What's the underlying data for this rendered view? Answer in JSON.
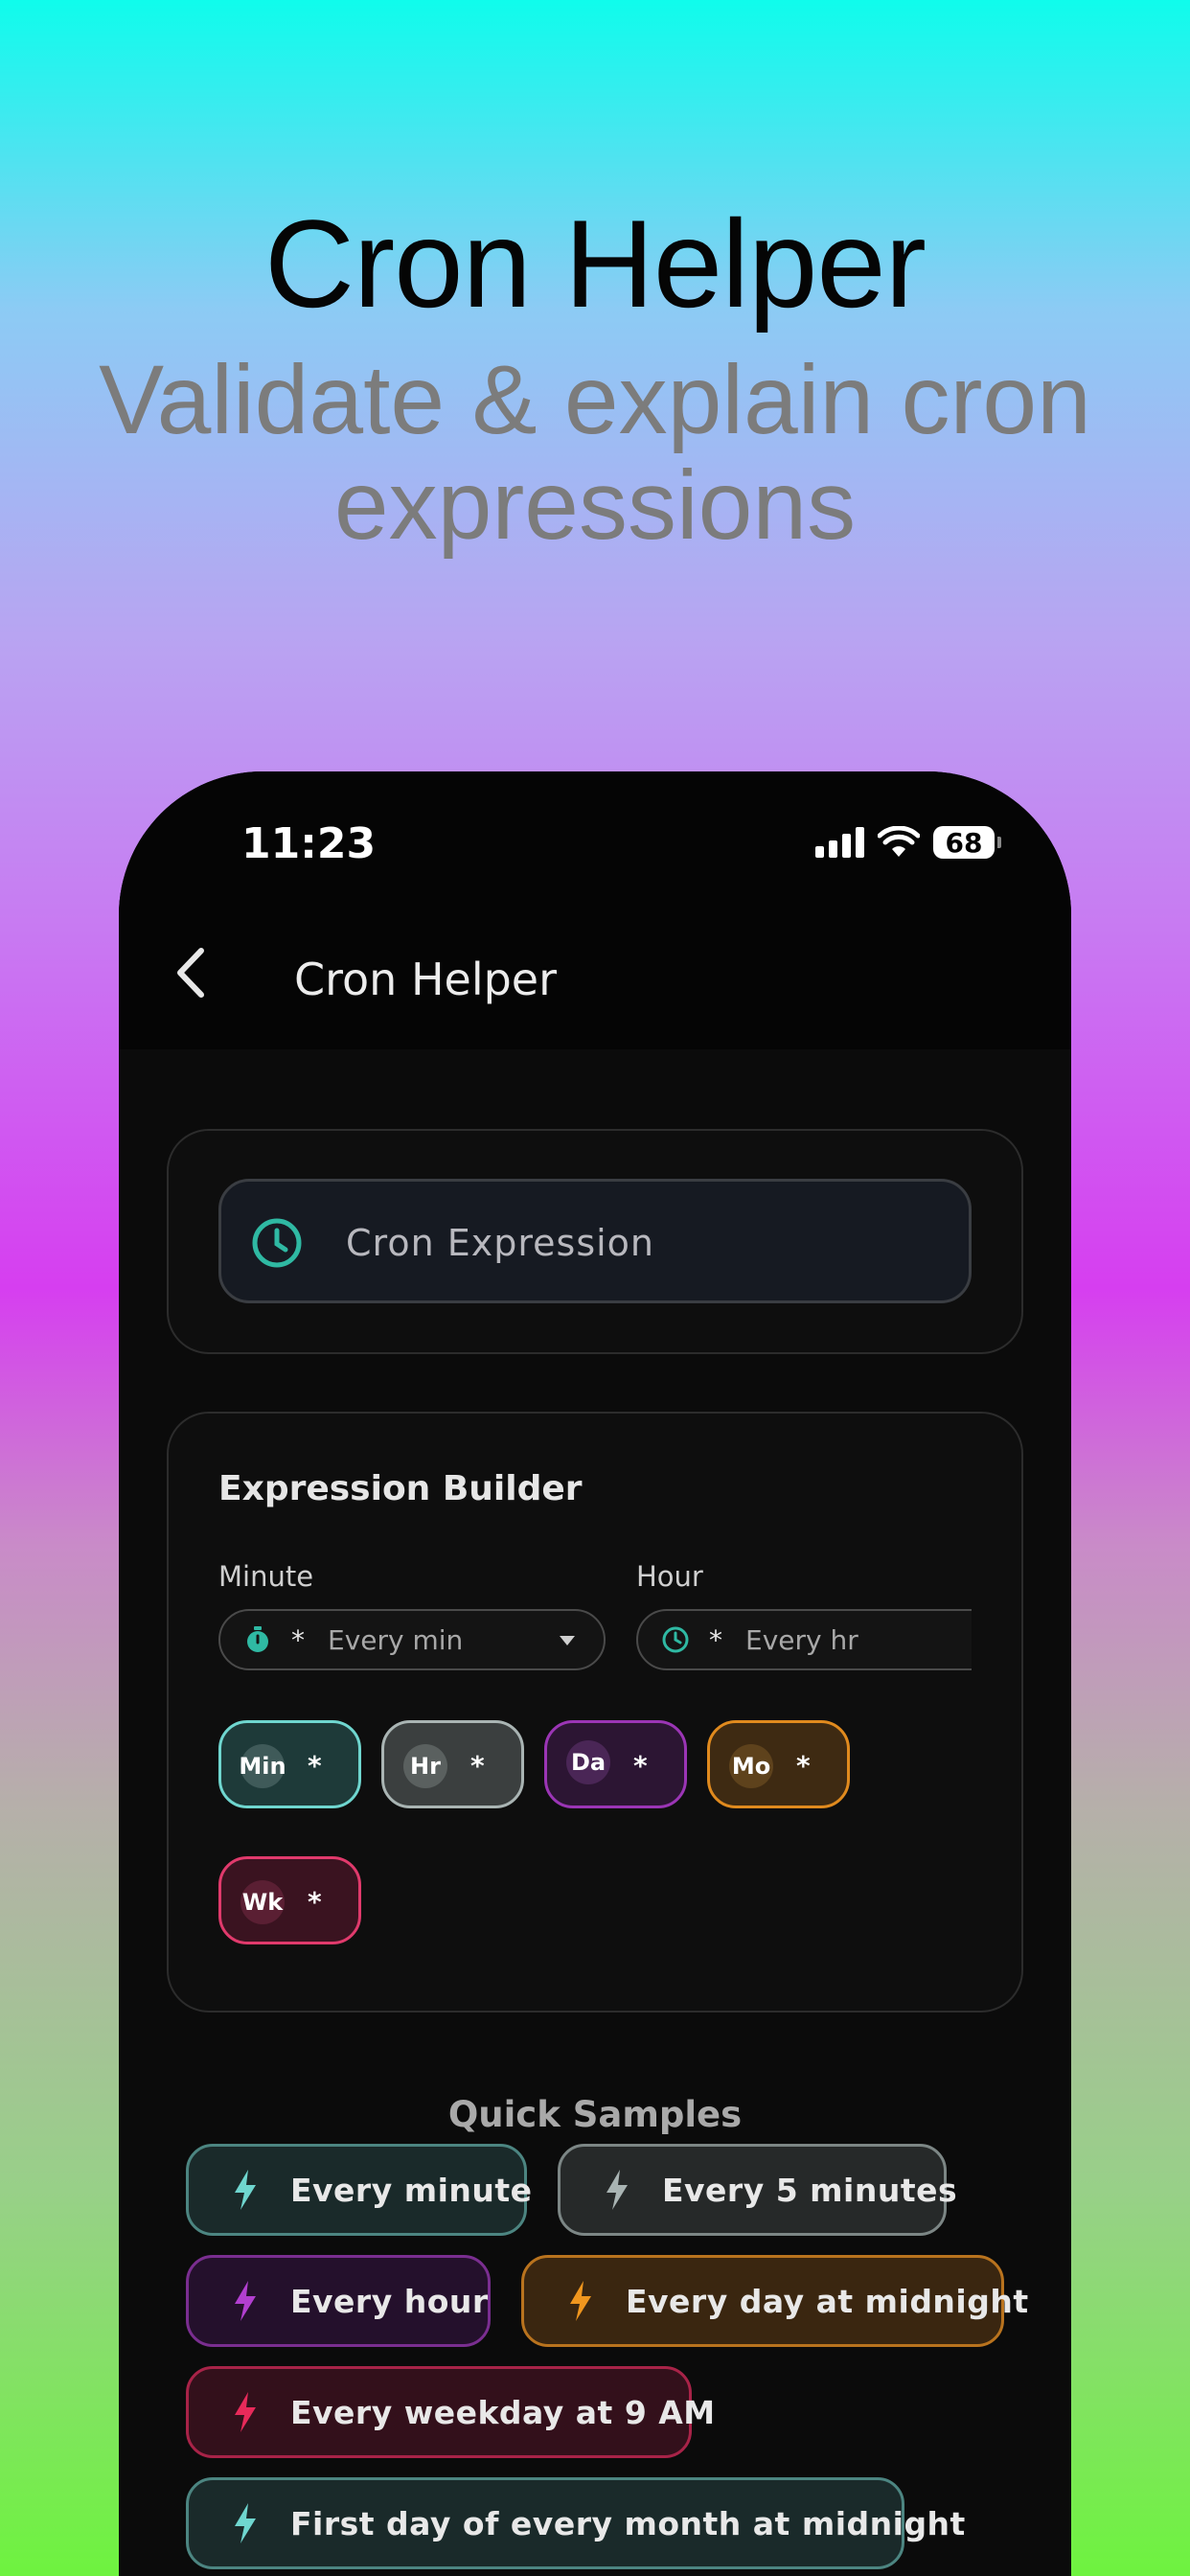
{
  "hero": {
    "title": "Cron Helper",
    "subtitle": "Validate & explain cron expressions"
  },
  "status_bar": {
    "time": "11:23",
    "battery": "68"
  },
  "app_bar": {
    "title": "Cron Helper"
  },
  "cron_input": {
    "placeholder": "Cron Expression"
  },
  "builder": {
    "title": "Expression Builder",
    "minute": {
      "label": "Minute",
      "value": "*",
      "text": "Every min"
    },
    "hour": {
      "label": "Hour",
      "value": "*",
      "text": "Every hr"
    },
    "chips": [
      {
        "badge": "Min",
        "value": "*",
        "color": "#6fd6cf"
      },
      {
        "badge": "Hr",
        "value": "*",
        "color": "#a9b4b3"
      },
      {
        "badge": "Da",
        "value": "*",
        "color": "#9b35b5"
      },
      {
        "badge": "Mo",
        "value": "*",
        "color": "#e08a1e"
      },
      {
        "badge": "Wk",
        "value": "*",
        "color": "#e03a6c"
      }
    ]
  },
  "quick_samples": {
    "title": "Quick Samples",
    "items": [
      {
        "label": "Every minute",
        "color": "#6fd6cf"
      },
      {
        "label": "Every 5 minutes",
        "color": "#a9b4b3"
      },
      {
        "label": "Every hour",
        "color": "#b23fd0"
      },
      {
        "label": "Every day at midnight",
        "color": "#f0961e"
      },
      {
        "label": "Every weekday at 9 AM",
        "color": "#e82a5a"
      },
      {
        "label": "First day of every month at midnight",
        "color": "#6fd6cf"
      }
    ]
  }
}
